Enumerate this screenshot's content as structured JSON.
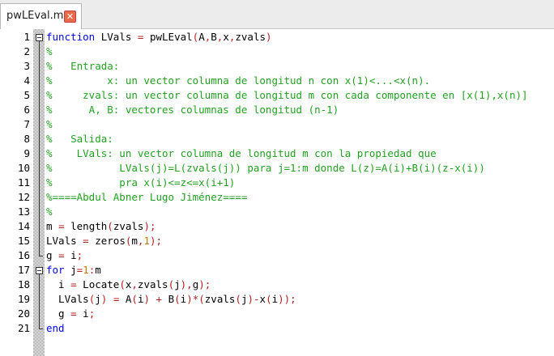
{
  "tab": {
    "label": "pwLEval.m",
    "close_glyph": "✕"
  },
  "colors": {
    "keyword": "#0000ff",
    "comment": "#22a022",
    "number": "#c87800",
    "operator": "#b22222",
    "text": "#000000",
    "close_button": "#e86a4a"
  },
  "editor": {
    "line_numbers": [
      "1",
      "2",
      "3",
      "4",
      "5",
      "6",
      "7",
      "8",
      "9",
      "10",
      "11",
      "12",
      "13",
      "14",
      "15",
      "16",
      "17",
      "18",
      "19",
      "20",
      "21"
    ],
    "lines": [
      [
        {
          "t": "function",
          "c": "kw"
        },
        {
          "t": " LVals ",
          "c": "tx"
        },
        {
          "t": "=",
          "c": "op"
        },
        {
          "t": " pwLEval",
          "c": "tx"
        },
        {
          "t": "(",
          "c": "op"
        },
        {
          "t": "A",
          "c": "tx"
        },
        {
          "t": ",",
          "c": "op"
        },
        {
          "t": "B",
          "c": "tx"
        },
        {
          "t": ",",
          "c": "op"
        },
        {
          "t": "x",
          "c": "tx"
        },
        {
          "t": ",",
          "c": "op"
        },
        {
          "t": "zvals",
          "c": "tx"
        },
        {
          "t": ")",
          "c": "op"
        }
      ],
      [
        {
          "t": "%",
          "c": "cm"
        }
      ],
      [
        {
          "t": "%   Entrada:",
          "c": "cm"
        }
      ],
      [
        {
          "t": "%         x: un vector columna de longitud n con x(1)<...<x(n).",
          "c": "cm"
        }
      ],
      [
        {
          "t": "%     zvals: un vector columna de longitud m con cada componente en [x(1),x(n)]",
          "c": "cm"
        }
      ],
      [
        {
          "t": "%      A, B: vectores columnas de longitud (n-1)",
          "c": "cm"
        }
      ],
      [
        {
          "t": "%",
          "c": "cm"
        }
      ],
      [
        {
          "t": "%   Salida:",
          "c": "cm"
        }
      ],
      [
        {
          "t": "%    LVals: un vector columna de longitud m con la propiedad que",
          "c": "cm"
        }
      ],
      [
        {
          "t": "%           LVals(j)=L(zvals(j)) para j=1:m donde L(z)=A(i)+B(i)(z-x(i))",
          "c": "cm"
        }
      ],
      [
        {
          "t": "%           pra x(i)<=z<=x(i+1)",
          "c": "cm"
        }
      ],
      [
        {
          "t": "%====Abdul Abner Lugo Jiménez====",
          "c": "cm"
        }
      ],
      [
        {
          "t": "%",
          "c": "cm"
        }
      ],
      [
        {
          "t": "m ",
          "c": "tx"
        },
        {
          "t": "=",
          "c": "op"
        },
        {
          "t": " length",
          "c": "tx"
        },
        {
          "t": "(",
          "c": "op"
        },
        {
          "t": "zvals",
          "c": "tx"
        },
        {
          "t": ");",
          "c": "op"
        }
      ],
      [
        {
          "t": "LVals ",
          "c": "tx"
        },
        {
          "t": "=",
          "c": "op"
        },
        {
          "t": " zeros",
          "c": "tx"
        },
        {
          "t": "(",
          "c": "op"
        },
        {
          "t": "m",
          "c": "tx"
        },
        {
          "t": ",",
          "c": "op"
        },
        {
          "t": "1",
          "c": "nm"
        },
        {
          "t": ");",
          "c": "op"
        }
      ],
      [
        {
          "t": "g ",
          "c": "tx"
        },
        {
          "t": "=",
          "c": "op"
        },
        {
          "t": " i",
          "c": "tx"
        },
        {
          "t": ";",
          "c": "op"
        }
      ],
      [
        {
          "t": "for",
          "c": "kw"
        },
        {
          "t": " j",
          "c": "tx"
        },
        {
          "t": "=",
          "c": "op"
        },
        {
          "t": "1",
          "c": "nm"
        },
        {
          "t": ":",
          "c": "op"
        },
        {
          "t": "m",
          "c": "tx"
        }
      ],
      [
        {
          "t": "  i ",
          "c": "tx"
        },
        {
          "t": "=",
          "c": "op"
        },
        {
          "t": " Locate",
          "c": "tx"
        },
        {
          "t": "(",
          "c": "op"
        },
        {
          "t": "x",
          "c": "tx"
        },
        {
          "t": ",",
          "c": "op"
        },
        {
          "t": "zvals",
          "c": "tx"
        },
        {
          "t": "(",
          "c": "op"
        },
        {
          "t": "j",
          "c": "tx"
        },
        {
          "t": "),",
          "c": "op"
        },
        {
          "t": "g",
          "c": "tx"
        },
        {
          "t": ");",
          "c": "op"
        }
      ],
      [
        {
          "t": "  LVals",
          "c": "tx"
        },
        {
          "t": "(",
          "c": "op"
        },
        {
          "t": "j",
          "c": "tx"
        },
        {
          "t": ")",
          "c": "op"
        },
        {
          "t": " ",
          "c": "tx"
        },
        {
          "t": "=",
          "c": "op"
        },
        {
          "t": " A",
          "c": "tx"
        },
        {
          "t": "(",
          "c": "op"
        },
        {
          "t": "i",
          "c": "tx"
        },
        {
          "t": ")",
          "c": "op"
        },
        {
          "t": " ",
          "c": "tx"
        },
        {
          "t": "+",
          "c": "op"
        },
        {
          "t": " B",
          "c": "tx"
        },
        {
          "t": "(",
          "c": "op"
        },
        {
          "t": "i",
          "c": "tx"
        },
        {
          "t": ")*(",
          "c": "op"
        },
        {
          "t": "zvals",
          "c": "tx"
        },
        {
          "t": "(",
          "c": "op"
        },
        {
          "t": "j",
          "c": "tx"
        },
        {
          "t": ")-",
          "c": "op"
        },
        {
          "t": "x",
          "c": "tx"
        },
        {
          "t": "(",
          "c": "op"
        },
        {
          "t": "i",
          "c": "tx"
        },
        {
          "t": "));",
          "c": "op"
        }
      ],
      [
        {
          "t": "  g ",
          "c": "tx"
        },
        {
          "t": "=",
          "c": "op"
        },
        {
          "t": " i",
          "c": "tx"
        },
        {
          "t": ";",
          "c": "op"
        }
      ],
      [
        {
          "t": "end",
          "c": "kw"
        }
      ]
    ]
  }
}
